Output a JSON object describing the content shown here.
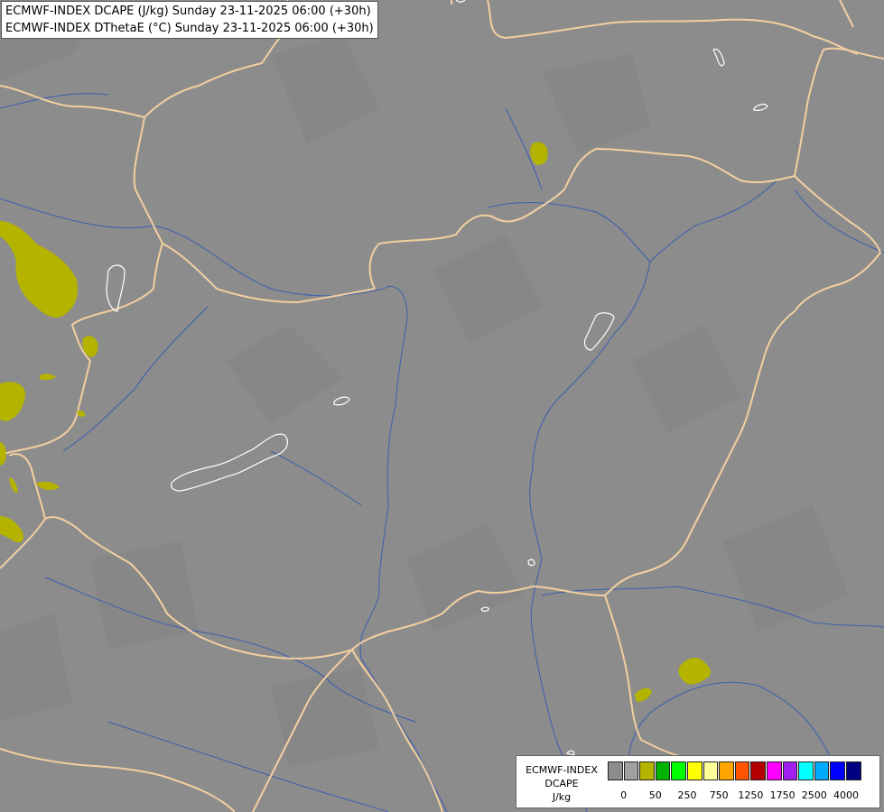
{
  "header": {
    "line1": "ECMWF-INDEX DCAPE (J/kg) Sunday 23-11-2025 06:00 (+30h)",
    "line2": "ECMWF-INDEX DThetaE (°C) Sunday 23-11-2025 06:00 (+30h)"
  },
  "map": {
    "background_color": "#8c8c8c",
    "border_color": "#f2cfa0",
    "river_color": "#3a5fb0",
    "lake_outline_color": "#ffffff",
    "dcape_area_color": "#b3b300"
  },
  "legend": {
    "line1": "ECMWF-INDEX",
    "line2": "DCAPE",
    "line3": "J/kg",
    "colors": [
      "#8c8c8c",
      "#a0a0a0",
      "#b3b300",
      "#00b300",
      "#00ff00",
      "#ffff00",
      "#ffff99",
      "#ffa500",
      "#ff5500",
      "#b30000",
      "#ff00ff",
      "#a020f0",
      "#00ffff",
      "#00aaff",
      "#0000ff",
      "#000080"
    ],
    "tick_labels": [
      "0",
      "50",
      "250",
      "750",
      "1250",
      "1750",
      "2500",
      "4000"
    ]
  }
}
